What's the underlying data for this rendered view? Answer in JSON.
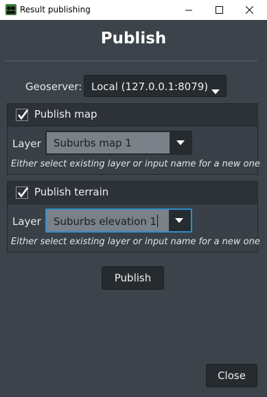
{
  "window": {
    "title": "Result publishing"
  },
  "heading": "Publish",
  "geoserver": {
    "label": "Geoserver:",
    "selected": "Local (127.0.0.1:8079)"
  },
  "publish_map": {
    "checkbox_label": "Publish map",
    "checked": true,
    "layer_label": "Layer",
    "layer_value": "Suburbs map 1",
    "hint": "Either select existing layer or input name for a new one"
  },
  "publish_terrain": {
    "checkbox_label": "Publish terrain",
    "checked": true,
    "layer_label": "Layer",
    "layer_value": "Suburbs elevation 1",
    "hint": "Either select existing layer or input name for a new one"
  },
  "buttons": {
    "publish": "Publish",
    "close": "Close"
  },
  "colors": {
    "background": "#3c434a",
    "focus_accent": "#2e8fd0",
    "app_icon": "#2f6b2f"
  }
}
